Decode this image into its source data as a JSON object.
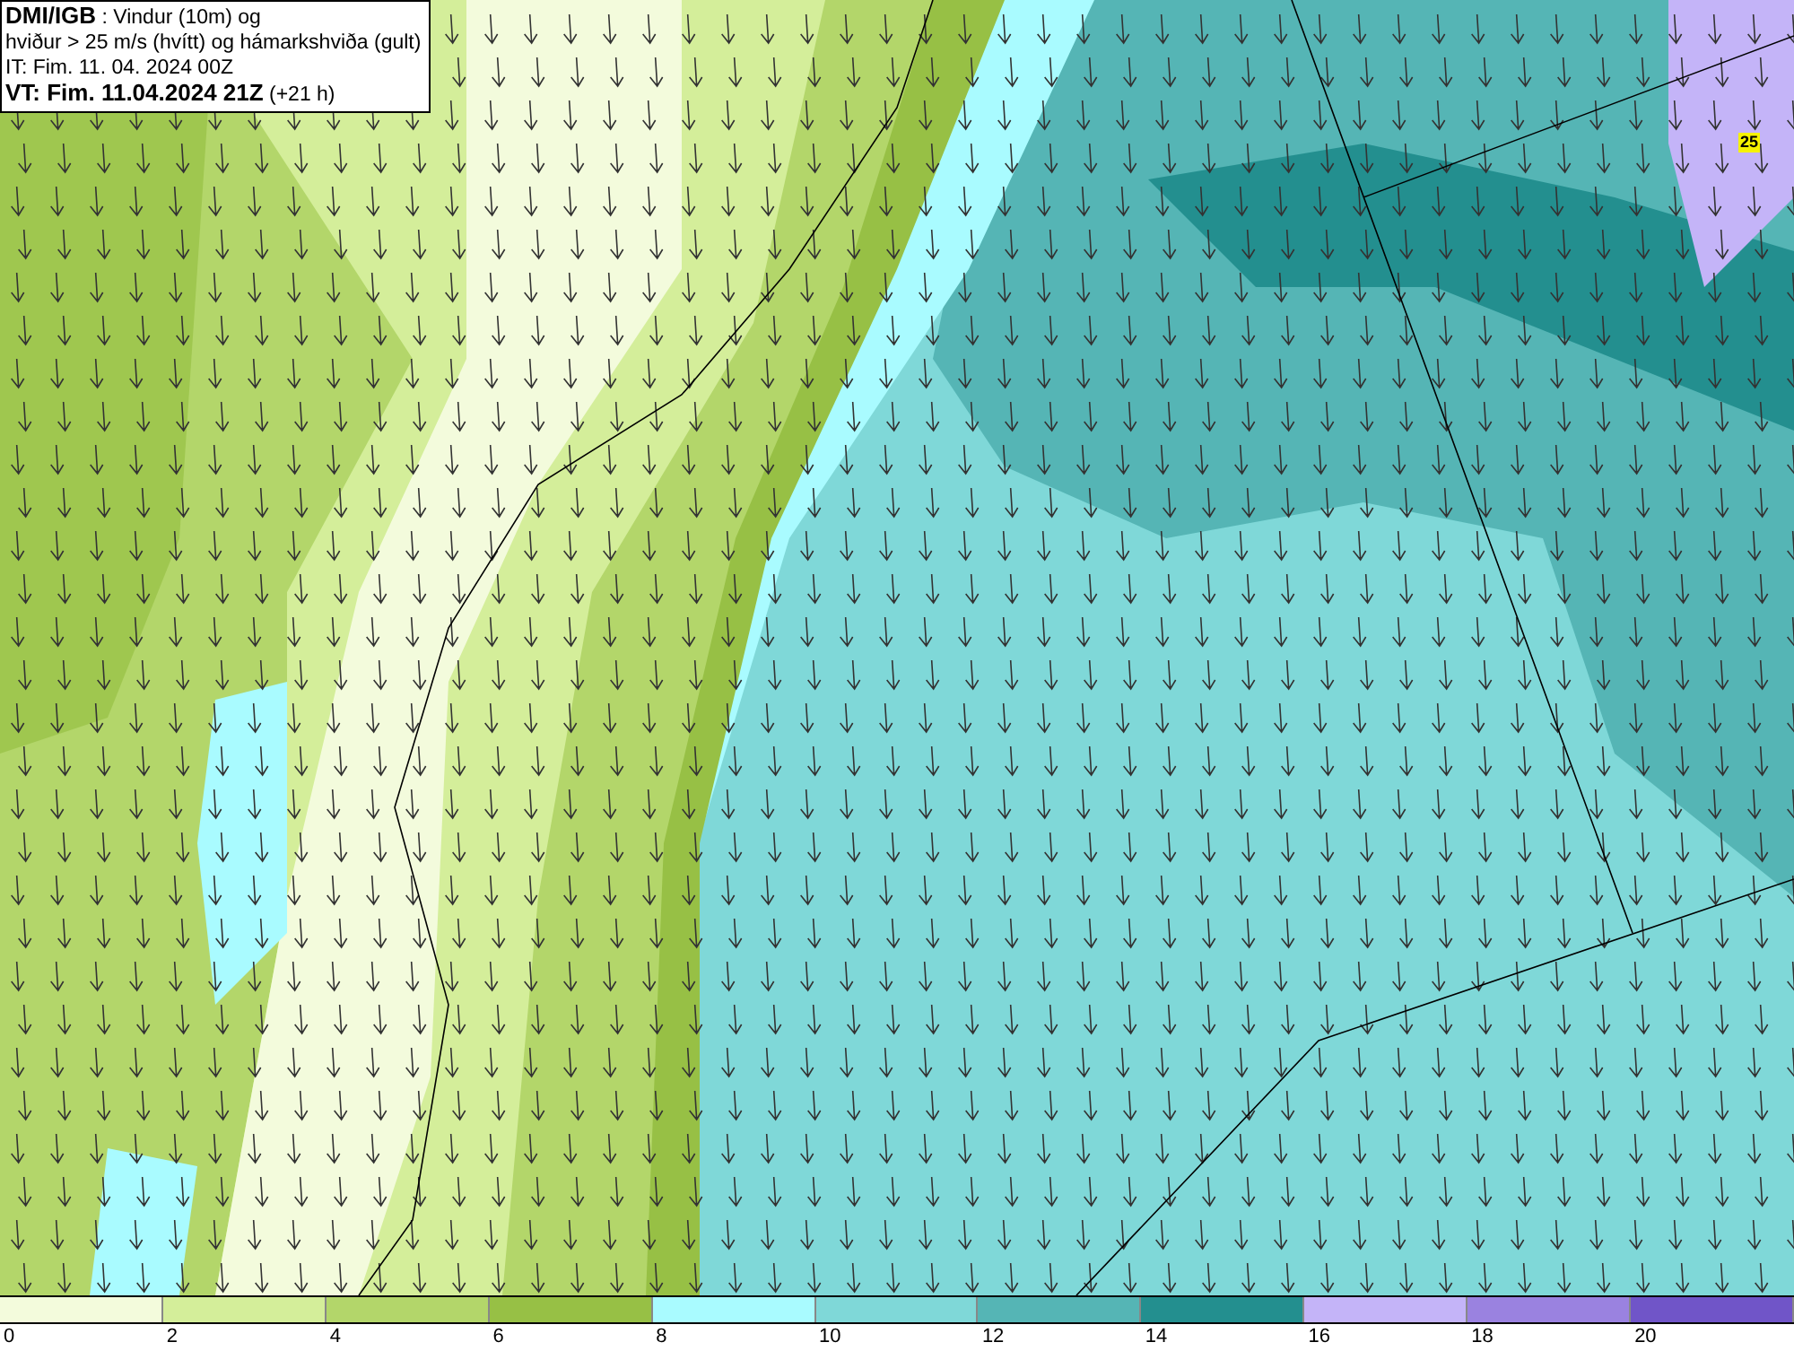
{
  "info_box": {
    "lines": [
      "**DMI/IGB** : Vindur (10m) og",
      "hviður > 25 m/s (hvítt) og hámarkshviða (gult)",
      "IT: Fim. 11. 04. 2024 00Z",
      "**VT: Fim. 11.04.2024 21Z** (+21 h)"
    ]
  },
  "map_marker": {
    "label": "25"
  },
  "legend": [
    {
      "label": "0",
      "color": "#f3fbdc"
    },
    {
      "label": "2",
      "color": "#d4ee9a"
    },
    {
      "label": "4",
      "color": "#b3d66a"
    },
    {
      "label": "6",
      "color": "#97c045"
    },
    {
      "label": "8",
      "color": "#a9fbff"
    },
    {
      "label": "10",
      "color": "#7fd8d8"
    },
    {
      "label": "12",
      "color": "#55b5b5"
    },
    {
      "label": "14",
      "color": "#238f8f"
    },
    {
      "label": "16",
      "color": "#c4b4f8"
    },
    {
      "label": "18",
      "color": "#9a82e0"
    },
    {
      "label": "20",
      "color": "#7055c8"
    }
  ]
}
